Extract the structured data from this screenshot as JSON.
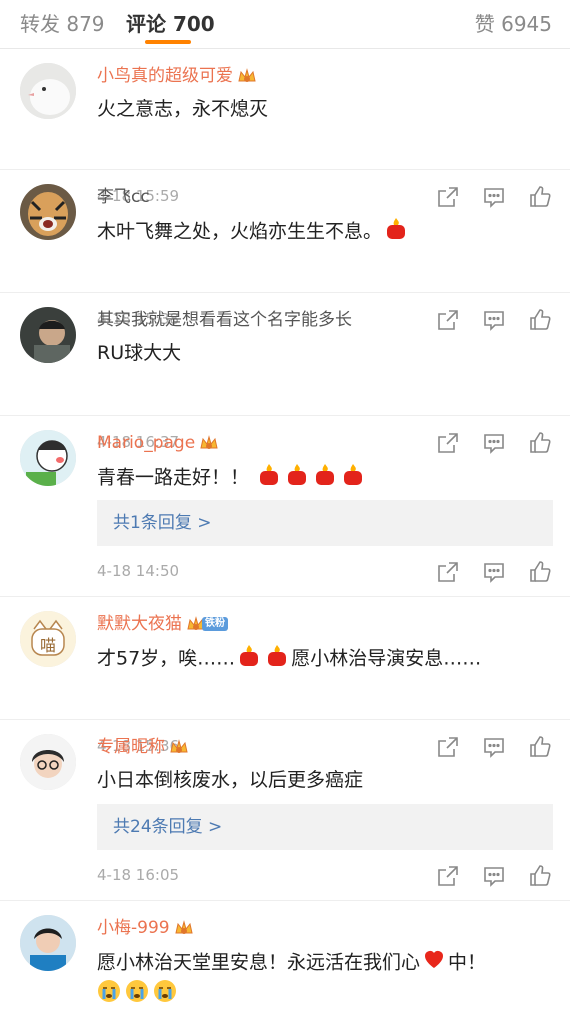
{
  "tabs": {
    "repost": "转发 879",
    "comments": "评论 700",
    "likes": "赞 6945"
  },
  "comments": [
    {
      "user": "小鸟真的超级可爱",
      "text": "火之意志，永不熄灭",
      "time": "4-18 15:59"
    },
    {
      "user": "李飞cc",
      "text": "木叶飞舞之处，火焰亦生生不息。",
      "time": "4-18 15:38"
    },
    {
      "user": "其实我就是想看看这个名字能多长",
      "text": "RU球大大",
      "time": "4-18 16:37"
    },
    {
      "user": "Mario_page",
      "text": "青春一路走好！！",
      "time": "4-18 14:50",
      "reply": "共1条回复 >"
    },
    {
      "user": "默默大夜猫",
      "badge": "铁粉",
      "text_a": "才57岁，唉……",
      "text_b": "愿小林治导演安息……",
      "time": "4-18 15:36"
    },
    {
      "user": "专属昵称",
      "text": "小日本倒核废水，以后更多癌症",
      "time": "4-18 16:05",
      "reply": "共24条回复 >"
    },
    {
      "user": "小梅-999",
      "text_a": "愿小林治天堂里安息！永远活在我们心",
      "text_b": "中！"
    }
  ],
  "colors": {
    "accent": "#ff8200",
    "vip_name": "#eb7350",
    "link": "#4d7ab2"
  }
}
